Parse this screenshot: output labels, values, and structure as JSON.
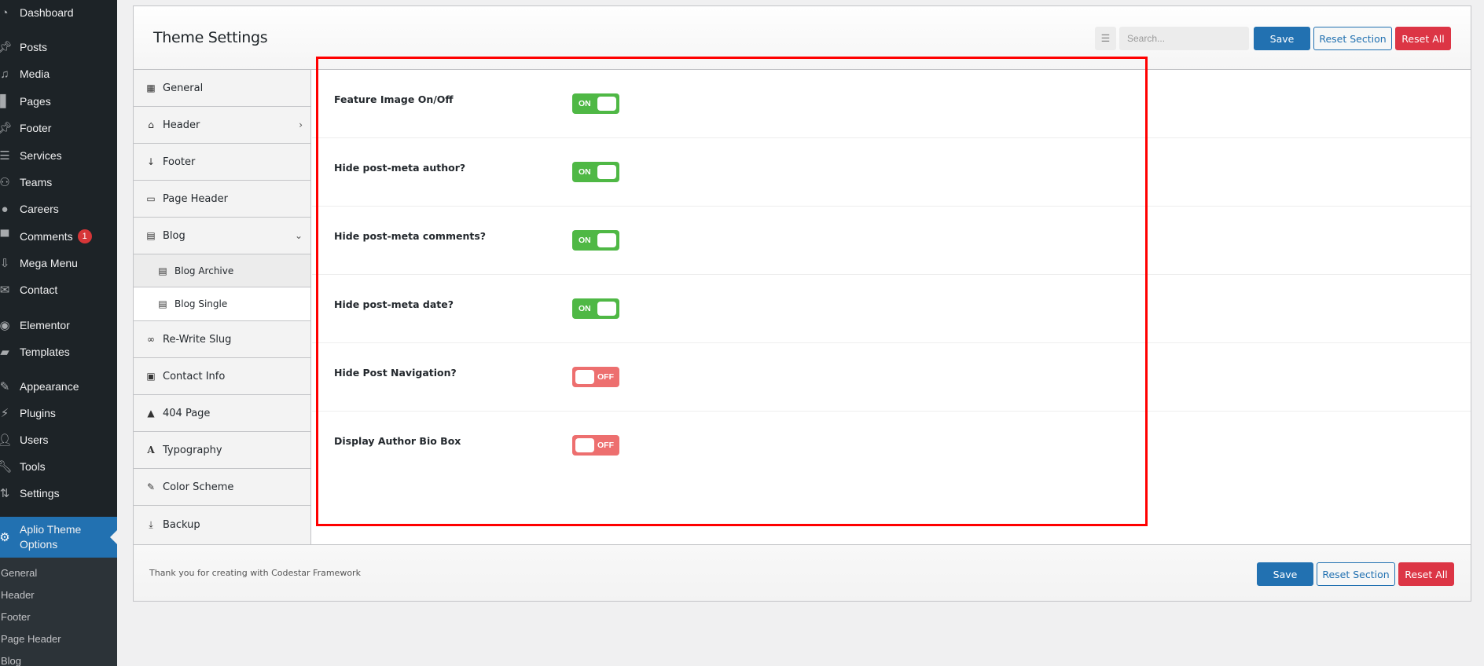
{
  "admin_menu": {
    "items": [
      {
        "label": "Dashboard",
        "icon": "dashboard-icon"
      },
      {
        "label": "Posts",
        "icon": "pin-icon"
      },
      {
        "label": "Media",
        "icon": "media-icon"
      },
      {
        "label": "Pages",
        "icon": "pages-icon"
      },
      {
        "label": "Footer",
        "icon": "pin-icon"
      },
      {
        "label": "Services",
        "icon": "list-icon"
      },
      {
        "label": "Teams",
        "icon": "groups-icon"
      },
      {
        "label": "Careers",
        "icon": "lightbulb-icon"
      },
      {
        "label": "Comments",
        "icon": "comment-icon",
        "badge": "1"
      },
      {
        "label": "Mega Menu",
        "icon": "download-icon"
      },
      {
        "label": "Contact",
        "icon": "email-icon"
      },
      {
        "label": "Elementor",
        "icon": "elementor-icon"
      },
      {
        "label": "Templates",
        "icon": "folder-icon"
      },
      {
        "label": "Appearance",
        "icon": "brush-icon"
      },
      {
        "label": "Plugins",
        "icon": "plugin-icon"
      },
      {
        "label": "Users",
        "icon": "user-icon"
      },
      {
        "label": "Tools",
        "icon": "wrench-icon"
      },
      {
        "label": "Settings",
        "icon": "settings-icon"
      }
    ],
    "active": {
      "label_line1": "Aplio Theme",
      "label_line2": "Options",
      "icon": "gear-icon"
    },
    "submenu": [
      "General",
      "Header",
      "Footer",
      "Page Header",
      "Blog"
    ]
  },
  "panel": {
    "title": "Theme Settings",
    "search_placeholder": "Search...",
    "buttons": {
      "save": "Save",
      "reset_section": "Reset Section",
      "reset_all": "Reset All"
    },
    "footer_text": "Thank you for creating with Codestar Framework"
  },
  "nav": {
    "items": [
      {
        "label": "General",
        "icon": "building-icon"
      },
      {
        "label": "Header",
        "icon": "home-icon",
        "chevron": "›"
      },
      {
        "label": "Footer",
        "icon": "arrow-down-icon"
      },
      {
        "label": "Page Header",
        "icon": "image-icon"
      },
      {
        "label": "Blog",
        "icon": "file-icon",
        "chevron": "⌄"
      },
      {
        "label": "Blog Archive",
        "icon": "file-icon",
        "sub": true
      },
      {
        "label": "Blog Single",
        "icon": "file-icon",
        "sub": true,
        "active": true
      },
      {
        "label": "Re-Write Slug",
        "icon": "link-icon"
      },
      {
        "label": "Contact Info",
        "icon": "id-card-icon"
      },
      {
        "label": "404 Page",
        "icon": "warning-icon"
      },
      {
        "label": "Typography",
        "icon": "font-icon"
      },
      {
        "label": "Color Scheme",
        "icon": "paint-brush-icon"
      },
      {
        "label": "Backup",
        "icon": "download-icon"
      }
    ]
  },
  "fields": [
    {
      "title": "Feature Image On/Off",
      "state": "ON",
      "on": true
    },
    {
      "title": "Hide post-meta author?",
      "state": "ON",
      "on": true
    },
    {
      "title": "Hide post-meta comments?",
      "state": "ON",
      "on": true
    },
    {
      "title": "Hide post-meta date?",
      "state": "ON",
      "on": true
    },
    {
      "title": "Hide Post Navigation?",
      "state": "OFF",
      "on": false
    },
    {
      "title": "Display Author Bio Box",
      "state": "OFF",
      "on": false
    }
  ],
  "colors": {
    "accent": "#2271b1",
    "danger": "#dc3545",
    "switch_on": "#4fb845",
    "switch_off": "#ed6f6f",
    "highlight": "#ff0000"
  }
}
